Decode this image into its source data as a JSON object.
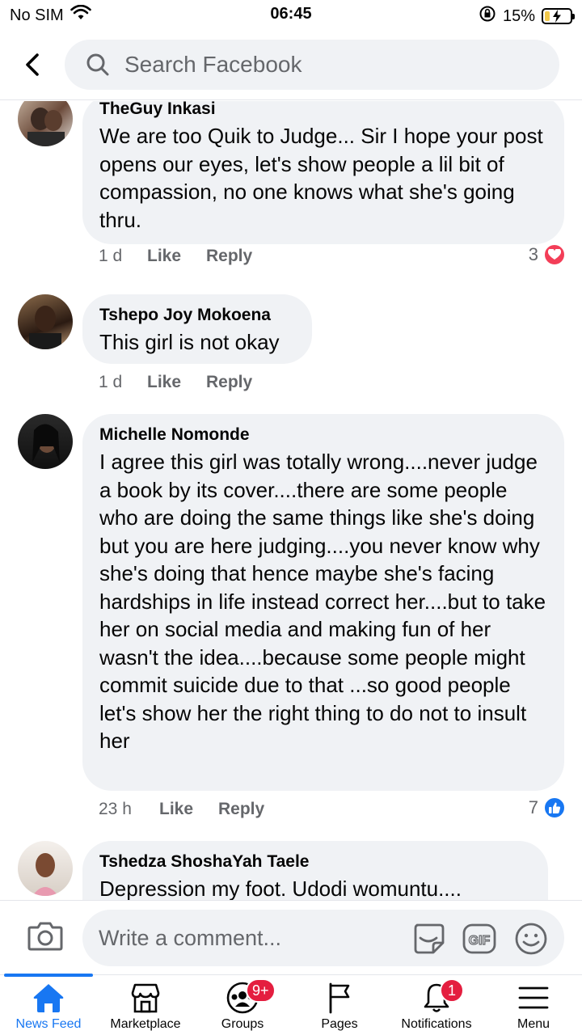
{
  "status_bar": {
    "carrier": "No SIM",
    "time": "06:45",
    "battery": "15%"
  },
  "search": {
    "placeholder": "Search Facebook"
  },
  "comments": [
    {
      "author": "TheGuy Inkasi",
      "text": "We are too Quik to Judge... Sir I hope your post opens our eyes, let's show people a lil bit of compassion, no one knows what she's going thru.",
      "time": "1 d",
      "like": "Like",
      "reply": "Reply",
      "reaction_count": "3",
      "reaction_type": "heart-reaction-icon"
    },
    {
      "author": "Tshepo Joy Mokoena",
      "text": "This girl is not okay",
      "time": "1 d",
      "like": "Like",
      "reply": "Reply"
    },
    {
      "author": "Michelle Nomonde",
      "text": "I agree this girl was totally wrong....never judge a book by its cover....there are some people  who are doing the same things like she's doing but you are here judging....you never know why she's doing that hence maybe she's facing  hardships in life instead correct her....but to take her on social media and making fun of her wasn't the idea....because some people might commit suicide due to that ...so good people  let's show her the right thing to do not to insult her",
      "time": "23 h",
      "like": "Like",
      "reply": "Reply",
      "reaction_count": "7",
      "reaction_type": "like-reaction-icon"
    },
    {
      "author": "Tshedza ShoshaYah Taele",
      "text": "Depression my foot. Udodi womuntu...."
    }
  ],
  "comment_bar": {
    "placeholder": "Write a comment..."
  },
  "tabs": [
    {
      "label": "News Feed",
      "active": true
    },
    {
      "label": "Marketplace"
    },
    {
      "label": "Groups",
      "badge": "9+"
    },
    {
      "label": "Pages"
    },
    {
      "label": "Notifications",
      "badge": "1"
    },
    {
      "label": "Menu"
    }
  ],
  "colors": {
    "accent": "#1877f2",
    "bubble": "#f0f2f5",
    "badge": "#e41e3f",
    "heart": "#f33e58"
  }
}
